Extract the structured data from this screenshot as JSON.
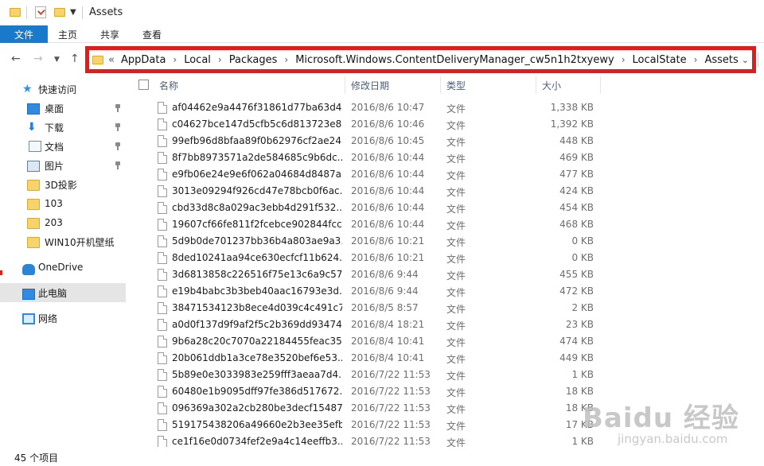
{
  "window": {
    "title": "Assets"
  },
  "ribbon": {
    "tabs": [
      "文件",
      "主页",
      "共享",
      "查看"
    ]
  },
  "address_bar": {
    "overflow": "«",
    "segments": [
      "AppData",
      "Local",
      "Packages",
      "Microsoft.Windows.ContentDeliveryManager_cw5n1h2txyewy",
      "LocalState",
      "Assets"
    ],
    "highlight_color": "#e21b1b"
  },
  "nav": {
    "back_icon": "arrow-left-icon",
    "forward_icon": "arrow-right-icon",
    "recent_icon": "chevron-down-icon",
    "up_icon": "arrow-up-icon"
  },
  "sidebar": {
    "quick_access": "快速访问",
    "pinned": [
      {
        "label": "桌面",
        "icon": "desktop-icon"
      },
      {
        "label": "下载",
        "icon": "download-icon"
      },
      {
        "label": "文档",
        "icon": "document-icon"
      },
      {
        "label": "图片",
        "icon": "picture-icon"
      }
    ],
    "folders": [
      {
        "label": "3D投影",
        "icon": "folder-icon"
      },
      {
        "label": "103",
        "icon": "folder-icon"
      },
      {
        "label": "203",
        "icon": "folder-icon"
      },
      {
        "label": "WIN10开机壁纸",
        "icon": "folder-icon"
      }
    ],
    "onedrive": "OneDrive",
    "this_pc": "此电脑",
    "network": "网络"
  },
  "columns": {
    "name": "名称",
    "date": "修改日期",
    "type": "类型",
    "size": "大小"
  },
  "files": [
    {
      "name": "af04462e9a4476f31861d77ba63d4...",
      "date": "2016/8/6 10:47",
      "type": "文件",
      "size": "1,338 KB"
    },
    {
      "name": "c04627bce147d5cfb5c6d813723e8...",
      "date": "2016/8/6 10:46",
      "type": "文件",
      "size": "1,392 KB"
    },
    {
      "name": "99efb96d8bfaa89f0b62976cf2ae24...",
      "date": "2016/8/6 10:45",
      "type": "文件",
      "size": "448 KB"
    },
    {
      "name": "8f7bb8973571a2de584685c9b6dc...",
      "date": "2016/8/6 10:44",
      "type": "文件",
      "size": "469 KB"
    },
    {
      "name": "e9fb06e24e9e6f062a04684d8487a...",
      "date": "2016/8/6 10:44",
      "type": "文件",
      "size": "477 KB"
    },
    {
      "name": "3013e09294f926cd47e78bcb0f6ac...",
      "date": "2016/8/6 10:44",
      "type": "文件",
      "size": "424 KB"
    },
    {
      "name": "cbd33d8c8a029ac3ebb4d291f532...",
      "date": "2016/8/6 10:44",
      "type": "文件",
      "size": "454 KB"
    },
    {
      "name": "19607cf66fe811f2fcebce902844fcc...",
      "date": "2016/8/6 10:44",
      "type": "文件",
      "size": "468 KB"
    },
    {
      "name": "5d9b0de701237bb36b4a803ae9a3...",
      "date": "2016/8/6 10:21",
      "type": "文件",
      "size": "0 KB"
    },
    {
      "name": "8ded10241aa94ce630ecfcf11b624...",
      "date": "2016/8/6 10:21",
      "type": "文件",
      "size": "0 KB"
    },
    {
      "name": "3d6813858c226516f75e13c6a9c57...",
      "date": "2016/8/6 9:44",
      "type": "文件",
      "size": "455 KB"
    },
    {
      "name": "e19b4babc3b3beb40aac16793e3d...",
      "date": "2016/8/6 9:44",
      "type": "文件",
      "size": "472 KB"
    },
    {
      "name": "38471534123b8ece4d039c4c491c7...",
      "date": "2016/8/5 8:57",
      "type": "文件",
      "size": "2 KB"
    },
    {
      "name": "a0d0f137d9f9af2f5c2b369dd93474...",
      "date": "2016/8/4 18:21",
      "type": "文件",
      "size": "23 KB"
    },
    {
      "name": "9b6a28c20c7070a22184455feac35...",
      "date": "2016/8/4 10:41",
      "type": "文件",
      "size": "474 KB"
    },
    {
      "name": "20b061ddb1a3ce78e3520bef6e53...",
      "date": "2016/8/4 10:41",
      "type": "文件",
      "size": "449 KB"
    },
    {
      "name": "5b89e0e3033983e259fff3aeaa7d4...",
      "date": "2016/7/22 11:53",
      "type": "文件",
      "size": "1 KB"
    },
    {
      "name": "60480e1b9095dff97fe386d517672...",
      "date": "2016/7/22 11:53",
      "type": "文件",
      "size": "18 KB"
    },
    {
      "name": "096369a302a2cb280be3decf15487...",
      "date": "2016/7/22 11:53",
      "type": "文件",
      "size": "18 KB"
    },
    {
      "name": "519175438206a49660e2b3ee35efb...",
      "date": "2016/7/22 11:53",
      "type": "文件",
      "size": "17 KB"
    },
    {
      "name": "ce1f16e0d0734fef2e9a4c14eeffb3...",
      "date": "2016/7/22 11:53",
      "type": "文件",
      "size": "1 KB"
    }
  ],
  "status": {
    "item_count": "45 个项目"
  },
  "watermark": {
    "main": "Baidu 经验",
    "sub": "jingyan.baidu.com"
  }
}
